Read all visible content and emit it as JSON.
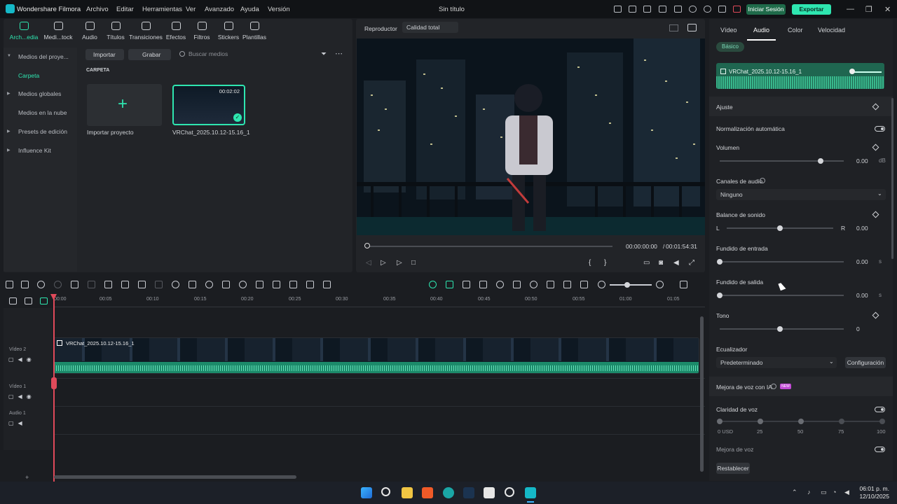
{
  "app": {
    "name": "Wondershare Filmora",
    "window_title": "Sin título",
    "menu": [
      "Archivo",
      "Editar",
      "Herramientas",
      "Ver",
      "Avanzado",
      "Ayuda",
      "Versión"
    ],
    "login_label": "Iniciar Sesión",
    "export_label": "Exportar",
    "accent": "#2ee6b0"
  },
  "toolbar": {
    "tools": [
      "Arch...edia",
      "Medi...tock",
      "Audio",
      "Títulos",
      "Transiciones",
      "Efectos",
      "Filtros",
      "Stickers",
      "Plantillas"
    ]
  },
  "media": {
    "sidebar": [
      "Medios del proye...",
      "Carpeta",
      "Medios globales",
      "Medios en la nube",
      "Presets de edición",
      "Influence Kit"
    ],
    "import_button": "Importar",
    "record_button": "Grabar",
    "search_placeholder": "Buscar medios",
    "folder_label": "CARPETA",
    "import_project_label": "Importar proyecto",
    "clip": {
      "name": "VRChat_2025.10.12-15.16_1",
      "duration": "00:02:02"
    }
  },
  "player": {
    "tab": "Reproductor",
    "quality": "Calidad total",
    "current_time": "00:00:00:00",
    "total_time": "00:01:54:31"
  },
  "right_panel": {
    "tabs": [
      "Vídeo",
      "Audio",
      "Color",
      "Velocidad"
    ],
    "basic_badge": "Básico",
    "clip_name": "VRChat_2025.10.12-15.16_1",
    "ajuste_label": "Ajuste",
    "normalizacion_label": "Normalización automática",
    "volumen_label": "Volumen",
    "volumen_value": "0.00",
    "volumen_unit": "dB",
    "canales_label": "Canales de audio",
    "canales_value": "Ninguno",
    "balance_label": "Balance de sonido",
    "balance_l": "L",
    "balance_r": "R",
    "balance_value": "0.00",
    "fade_in_label": "Fundido de entrada",
    "fade_in_value": "0.00",
    "fade_out_label": "Fundido  de salida",
    "fade_out_value": "0.00",
    "seconds_unit": "s",
    "tono_label": "Tono",
    "tono_value": "0",
    "eq_label": "Ecualizador",
    "eq_value": "Predeterminado",
    "config_button": "Configuración",
    "ai_label": "Mejora de voz con IA",
    "new_badge": "NEW",
    "claridad_label": "Claridad de voz",
    "claridad_ticks": [
      "0 USD",
      "25",
      "50",
      "75",
      "100"
    ],
    "mejora_label": "Mejora de voz",
    "reset_button": "Restablecer"
  },
  "timeline": {
    "ruler": [
      "00:00",
      "00:05",
      "00:10",
      "00:15",
      "00:20",
      "00:25",
      "00:30",
      "00:35",
      "00:40",
      "00:45",
      "00:50",
      "00:55",
      "01:00",
      "01:05"
    ],
    "tracks": [
      "Vídeo 2",
      "Vídeo 1",
      "Audio 1"
    ],
    "clip_name": "VRChat_2025.10.12-15.16_1"
  },
  "taskbar": {
    "time": "06:01 p. m.",
    "date": "12/10/2025"
  }
}
